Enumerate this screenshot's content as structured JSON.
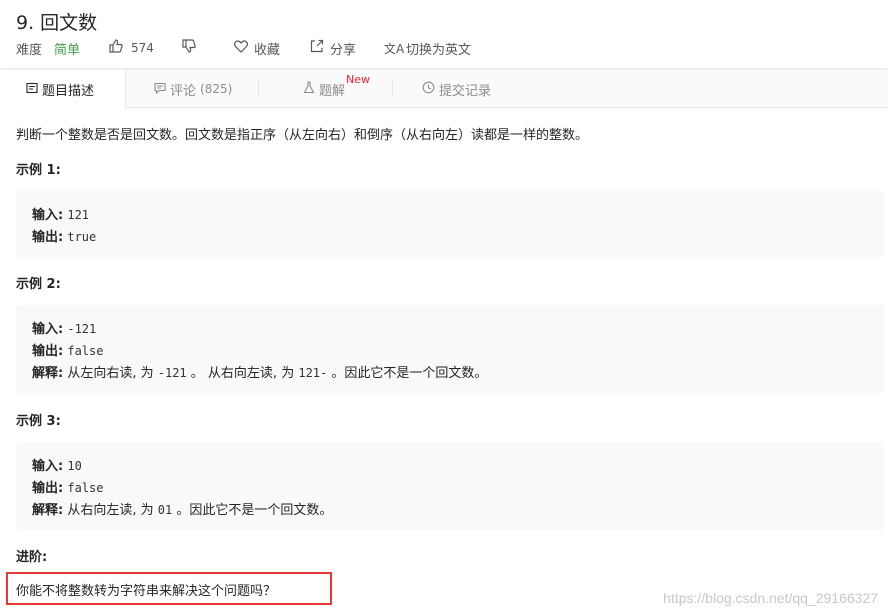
{
  "problem": {
    "title": "9. 回文数",
    "difficulty_label": "难度",
    "difficulty_value": "简单",
    "likes": "574",
    "favorite_label": "收藏",
    "share_label": "分享",
    "switch_lang_label": "切换为英文"
  },
  "tabs": [
    {
      "label": "题目描述",
      "icon": "document-icon"
    },
    {
      "label": "评论",
      "count": "(825)",
      "icon": "comment-icon"
    },
    {
      "label": "题解",
      "badge": "New",
      "icon": "flask-icon"
    },
    {
      "label": "提交记录",
      "icon": "clock-icon"
    }
  ],
  "description": "判断一个整数是否是回文数。回文数是指正序（从左向右）和倒序（从右向左）读都是一样的整数。",
  "examples": [
    {
      "title": "示例 1:",
      "input_label": "输入:",
      "input": "121",
      "output_label": "输出:",
      "output": "true"
    },
    {
      "title": "示例 2:",
      "input_label": "输入:",
      "input": "-121",
      "output_label": "输出:",
      "output": "false",
      "explain_label": "解释:",
      "explain_1": "从左向右读, 为",
      "explain_code_1": "-121",
      "explain_2": "。 从右向左读, 为",
      "explain_code_2": "121-",
      "explain_3": "。因此它不是一个回文数。"
    },
    {
      "title": "示例 3:",
      "input_label": "输入:",
      "input": "10",
      "output_label": "输出:",
      "output": "false",
      "explain_label": "解释:",
      "explain_1": "从右向左读, 为",
      "explain_code_1": "01",
      "explain_2": "。因此它不是一个回文数。"
    }
  ],
  "advance": {
    "title": "进阶:",
    "text": "你能不将整数转为字符串来解决这个问题吗？",
    "highlight_color": "#e53935"
  },
  "watermark": "https://blog.csdn.net/qq_29166327",
  "colors": {
    "easy": "#43a047",
    "new_badge": "#f5222d"
  }
}
